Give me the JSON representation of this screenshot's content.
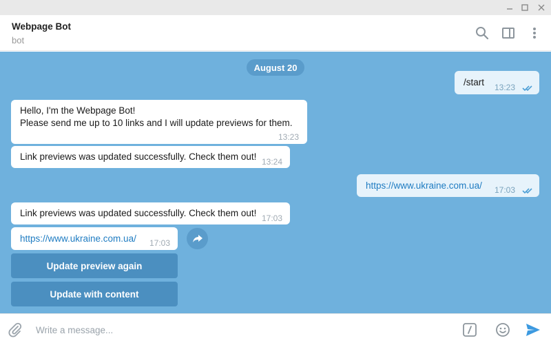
{
  "window": {
    "controls": [
      "minimize-icon",
      "maximize-icon",
      "close-icon"
    ]
  },
  "header": {
    "title": "Webpage Bot",
    "subtitle": "bot",
    "icons": [
      "search-icon",
      "sidebar-panel-icon",
      "more-vertical-icon"
    ]
  },
  "chat": {
    "date_label": "August 20",
    "messages": [
      {
        "direction": "out",
        "text": "/start",
        "time": "13:23",
        "status": "read"
      },
      {
        "direction": "in",
        "line1": "Hello, I'm the Webpage Bot!",
        "line2": "Please send me up to 10 links and I will update previews for them.",
        "time": "13:23"
      },
      {
        "direction": "in",
        "text": "Link previews was updated successfully. Check them out!",
        "time": "13:24"
      },
      {
        "direction": "out",
        "text": "https://www.ukraine.com.ua/",
        "time": "17:03",
        "status": "read"
      },
      {
        "direction": "in",
        "text": "Link previews was updated successfully. Check them out!",
        "time": "17:03"
      },
      {
        "direction": "in",
        "text": "https://www.ukraine.com.ua/",
        "time": "17:03"
      }
    ],
    "keyboard": [
      {
        "label": "Update preview again"
      },
      {
        "label": "Update with content"
      }
    ]
  },
  "compose": {
    "placeholder": "Write a message...",
    "icons": [
      "paperclip-icon",
      "bot-command-icon",
      "emoji-icon",
      "send-icon"
    ]
  },
  "colors": {
    "chat_background": "#6fb1dd",
    "pill": "#5a9ccb",
    "keyboard_button": "#4b8fc0",
    "outgoing_bubble": "#e7f3fb",
    "link": "#1f7cc2",
    "send": "#3d9ae0"
  }
}
